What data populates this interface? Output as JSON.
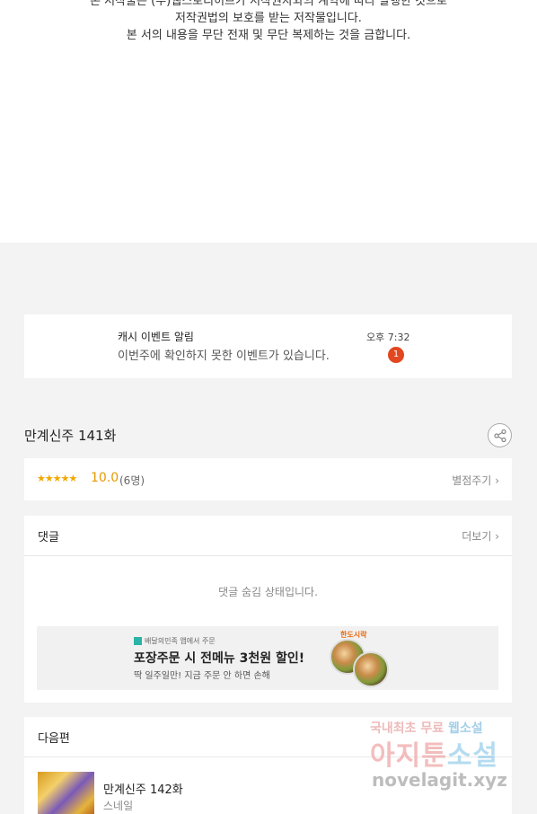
{
  "notice": {
    "line1": "본 저작물은 (주)웹스토리허브가 저작권자와의 계약에 따라 발행한 것으로",
    "line2": "저작권법의 보호를 받는 저작물입니다.",
    "line3": "본 서의 내용을 무단 전재 및 무단 복제하는 것을 금합니다."
  },
  "alarm": {
    "title": "캐시 이벤트 알림",
    "message": "이번주에 확인하지 못한 이벤트가 있습니다.",
    "time": "오후 7:32",
    "badge": "1"
  },
  "episode": {
    "title": "만계신주 141화",
    "share_icon": "share-icon"
  },
  "rating": {
    "stars": "★★★★★",
    "score": "10.0",
    "count": "(6명)",
    "rate_label": "별점주기",
    "score_value": 10.0,
    "score_max": 10
  },
  "comments": {
    "label": "댓글",
    "more_label": "더보기",
    "hidden_message": "댓글 숨김 상태입니다."
  },
  "ad": {
    "brand": "배달의민족 앱에서 주문",
    "headline": "포장주문 시 전메뉴 3천원 할인!",
    "sub": "딱 일주일만! 지금 주문 안 하면 손해",
    "shop": "한도시락"
  },
  "next": {
    "label": "다음편",
    "episode_title": "만계신주 142화",
    "author": "스네일"
  },
  "watermark": {
    "line1_a": "국내최초 무료 ",
    "line1_b": "웹소설",
    "line2_a": "아지툰",
    "line2_b": "소설",
    "line3": "novelagit.xyz"
  },
  "colors": {
    "accent_star": "#f0a800",
    "badge": "#e2471f",
    "background": "#f3f3f3"
  }
}
